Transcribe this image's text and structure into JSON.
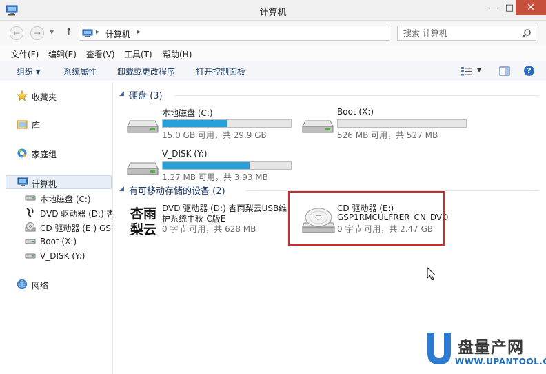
{
  "window": {
    "title": "计算机",
    "minimize_glyph": "—",
    "maximize_glyph": "□",
    "close_glyph": "✕"
  },
  "navigation": {
    "breadcrumb": [
      "计算机"
    ],
    "search_placeholder": "搜索 计算机"
  },
  "menu": {
    "items": [
      "文件(F)",
      "编辑(E)",
      "查看(V)",
      "工具(T)",
      "帮助(H)"
    ]
  },
  "commands": {
    "organize": "组织",
    "system_properties": "系统属性",
    "uninstall_program": "卸载或更改程序",
    "open_control_panel": "打开控制面板",
    "help_glyph": "?"
  },
  "sidebar": {
    "favorites": "收藏夹",
    "libraries": "库",
    "homegroup": "家庭组",
    "computer": "计算机",
    "computer_items": [
      "本地磁盘 (C:)",
      "DVD 驱动器 (D:) 杏",
      "CD 驱动器 (E:) GSP",
      "Boot (X:)",
      "V_DISK (Y:)"
    ],
    "network": "网络"
  },
  "groups": {
    "hard_disks": "硬盘 (3)",
    "removable": "有可移动存储的设备 (2)"
  },
  "drives": [
    {
      "name": "本地磁盘 (C:)",
      "size_text": "15.0 GB 可用，共 29.9 GB",
      "used_fraction": 0.5
    },
    {
      "name": "Boot (X:)",
      "size_text": "526 MB 可用，共 527 MB",
      "used_fraction": 0.0
    },
    {
      "name": "V_DISK (Y:)",
      "size_text": "1.27 MB 可用，共 3.93 MB",
      "used_fraction": 0.68
    }
  ],
  "removable_devices": [
    {
      "line1": "DVD 驱动器 (D:) 杏雨梨云USB维",
      "line2": "护系统中秋-C版E",
      "line3": "0 字节 可用，共 628 MB"
    },
    {
      "line1": "CD 驱动器 (E:)",
      "line2": "GSP1RMCULFRER_CN_DVD",
      "line3": "0 字节 可用，共 2.47 GB"
    }
  ],
  "dvd_label_art": "杏雨梨云",
  "watermark": {
    "brand": "盘量产网",
    "url": "WWW.UPANTOOL.COM"
  },
  "colors": {
    "accent": "#26a0da",
    "highlight": "#d22a2a",
    "close_button": "#c7503c",
    "watermark_url": "#1f6fc4"
  }
}
